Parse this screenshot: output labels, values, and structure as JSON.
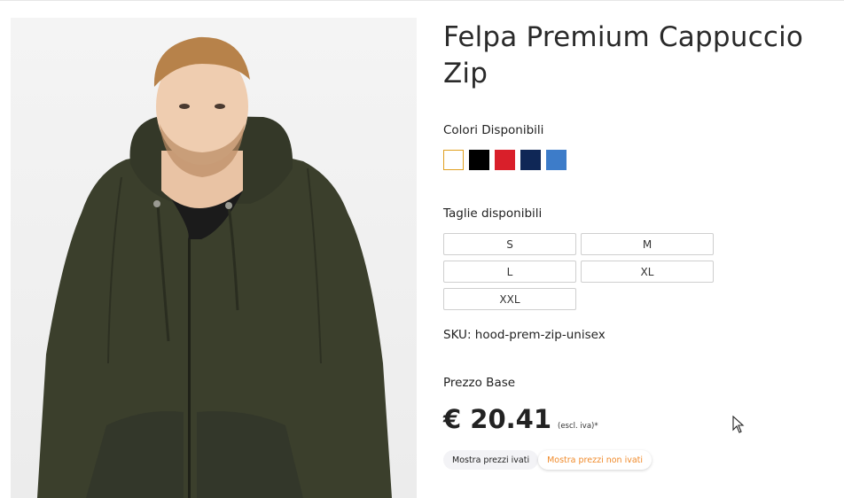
{
  "product": {
    "title": "Felpa Premium Cappuccio Zip",
    "image_alt": "Uomo con felpa con cappuccio e zip verde militare",
    "colors_label": "Colori Disponibili",
    "colors": [
      {
        "name": "Bianco",
        "hex": "#ffffff",
        "selected": true
      },
      {
        "name": "Nero",
        "hex": "#000000",
        "selected": false
      },
      {
        "name": "Rosso",
        "hex": "#d91f2a",
        "selected": false
      },
      {
        "name": "Blu navy",
        "hex": "#0f2756",
        "selected": false
      },
      {
        "name": "Azzurro",
        "hex": "#3d7cc9",
        "selected": false
      }
    ],
    "sizes_label": "Taglie disponibili",
    "sizes": [
      "S",
      "M",
      "L",
      "XL",
      "XXL"
    ],
    "sku": "SKU: hood-prem-zip-unisex",
    "price_label": "Prezzo Base",
    "price": "€ 20.41",
    "price_note": "(escl. iva)*",
    "toggle": {
      "with_vat": "Mostra prezzi ivati",
      "without_vat": "Mostra prezzi non ivati",
      "active": "without_vat"
    }
  },
  "colors": {
    "accent": "#f08a2a",
    "selected_border": "#e0a020",
    "hoodie": "#3a3f2c"
  }
}
